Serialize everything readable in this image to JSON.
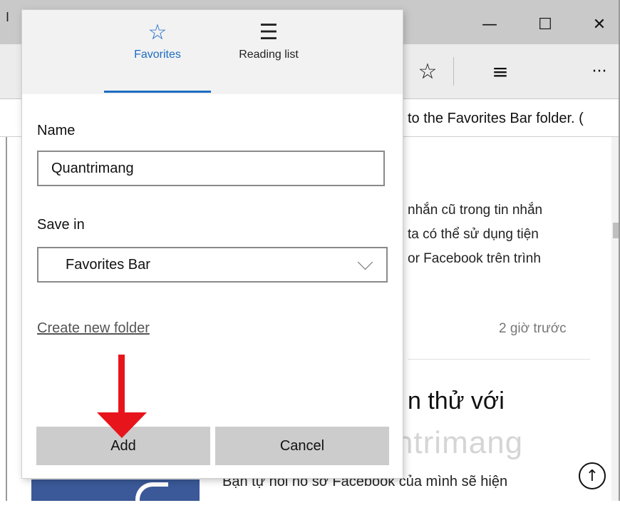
{
  "browser": {
    "tab_fragment": "I",
    "window_controls": {
      "minimize": "—",
      "maximize": "☐",
      "close": "✕"
    },
    "toolbar_icons": {
      "favorites": "☆",
      "hub": "≡",
      "more": "···"
    },
    "favorites_bar_text": "to the Favorites Bar folder. (",
    "page": {
      "paragraph_lines": [
        "nhắn cũ trong tin nhắn",
        "ta có thể sử dụng tiện",
        "or Facebook trên trình"
      ],
      "timestamp": "2 giờ trước",
      "headline": "n thử với",
      "snippet": "Bạn tự nói nó sơ Facebook của mình sẽ hiện",
      "scroll_up_icon": "↑"
    },
    "watermark": "uantrimang"
  },
  "flyout": {
    "tabs": [
      {
        "label": "Favorites",
        "icon": "☆",
        "selected": true
      },
      {
        "label": "Reading list",
        "icon": "☰"
      }
    ],
    "name_label": "Name",
    "name_value": "Quantrimang",
    "save_in_label": "Save in",
    "save_in_value": "Favorites Bar",
    "create_folder_link": "Create new folder",
    "add_button": "Add",
    "cancel_button": "Cancel"
  },
  "colors": {
    "accent": "#1c6cc4",
    "annotation_arrow": "#e8141b",
    "button_bg": "#cccccc"
  }
}
